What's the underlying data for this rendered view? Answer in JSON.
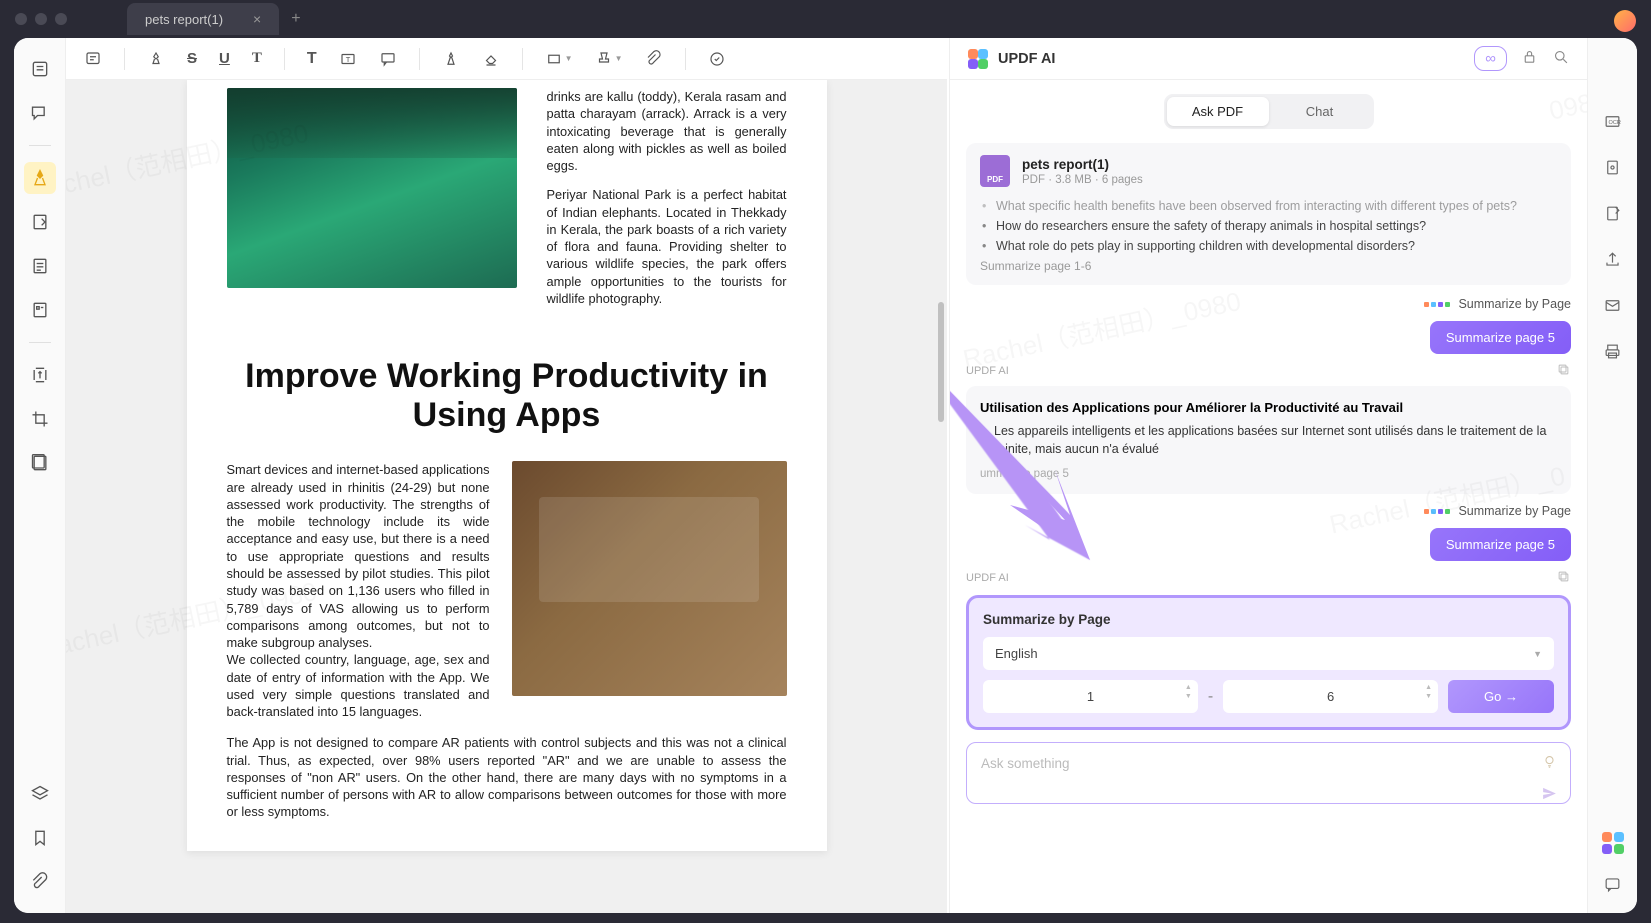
{
  "tab": {
    "title": "pets report(1)"
  },
  "ai": {
    "title": "UPDF AI",
    "modes": {
      "ask": "Ask PDF",
      "chat": "Chat"
    },
    "file": {
      "name": "pets report(1)",
      "meta": "PDF · 3.8 MB · 6 pages"
    },
    "questions": [
      "What specific health benefits have been observed from interacting with different types of pets?",
      "How do researchers ensure the safety of therapy animals in hospital settings?",
      "What role do pets play in supporting children with developmental disorders?"
    ],
    "summ_range_1": "Summarize page 1-6",
    "sbp_label": "Summarize by Page",
    "summarize_btn": "Summarize page 5",
    "ai_label": "UPDF AI",
    "msg2": {
      "title": "Utilisation des Applications pour Améliorer la Productivité au Travail",
      "bullet": "Les appareils intelligents et les applications basées sur Internet sont utilisés dans le traitement de la rhinite, mais aucun n'a évalué",
      "note": "ummarize page 5"
    },
    "sbp_card": {
      "title": "Summarize by Page",
      "lang": "English",
      "from": "1",
      "to": "6",
      "go": "Go →"
    },
    "prompt_placeholder": "Ask something"
  },
  "doc": {
    "p1a": "drinks are kallu (toddy), Kerala rasam and patta charayam (arrack). Arrack is a very intoxicating beverage that is generally eaten along with pickles as well as boiled eggs.",
    "p1b": "Periyar National Park is a perfect habitat of Indian elephants. Located in Thekkady in Kerala, the park boasts of a rich variety of flora and fauna. Providing shelter to various wildlife species, the park offers ample opportunities to the tourists for wildlife photography.",
    "heading": "Improve Working Productivity in Using Apps",
    "p2a": "Smart devices and internet-based applications are already used in rhinitis (24-29) but none assessed work productivity. The strengths of the mobile technology include its wide acceptance and easy use, but there is a need to use appropriate questions and results should be assessed by pilot studies. This pilot study was based on 1,136 users who filled in 5,789 days of VAS allowing us to perform comparisons among outcomes, but not to make subgroup analyses.",
    "p2b": "We collected country, language, age, sex and date of entry of information with the App. We used very simple questions translated and back-translated into 15 languages.",
    "p3": "The App is not designed to compare AR patients with control subjects and this was not a clinical trial. Thus, as expected, over 98% users reported \"AR\" and we are unable to assess the responses of \"non AR\" users. On the other hand, there are many days with no symptoms in a sufficient number of persons with AR to allow comparisons between outcomes for those with more or less symptoms."
  }
}
